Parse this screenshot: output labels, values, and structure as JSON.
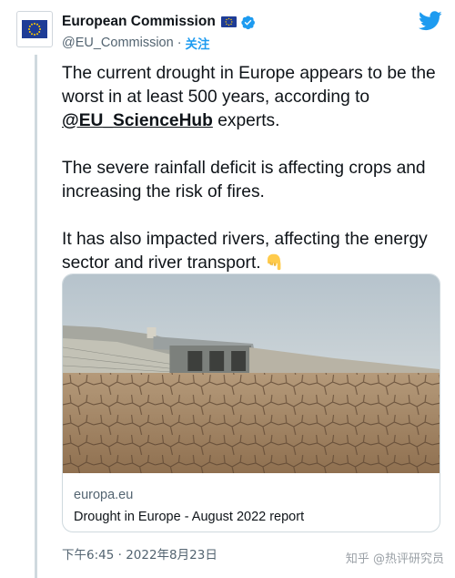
{
  "author": {
    "display_name": "European Commission",
    "handle": "@EU_Commission",
    "separator": "·",
    "follow_label": "关注",
    "avatar_icon": "eu-flag-icon",
    "badge_icon": "verified-badge-icon"
  },
  "tweet": {
    "para1_before": "The current drought in Europe appears to be the worst in at least 500 years, according to ",
    "para1_mention": "@EU_ScienceHub",
    "para1_after": " experts.",
    "para2": "The severe rainfall deficit is affecting crops and increasing the risk of fires.",
    "para3": "It has also impacted rivers, affecting the energy sector and river transport.",
    "emoji_icon": "pointing-down-hand-icon"
  },
  "card": {
    "domain": "europa.eu",
    "title": "Drought in Europe - August 2022 report"
  },
  "timestamp": "下午6:45 · 2022年8月23日",
  "watermark": "知乎 @热评研究员",
  "colors": {
    "accent": "#1d9bf0",
    "text": "#0f1419",
    "muted": "#536471",
    "eu_blue": "#1e3c96",
    "eu_star": "#ffcc00"
  }
}
